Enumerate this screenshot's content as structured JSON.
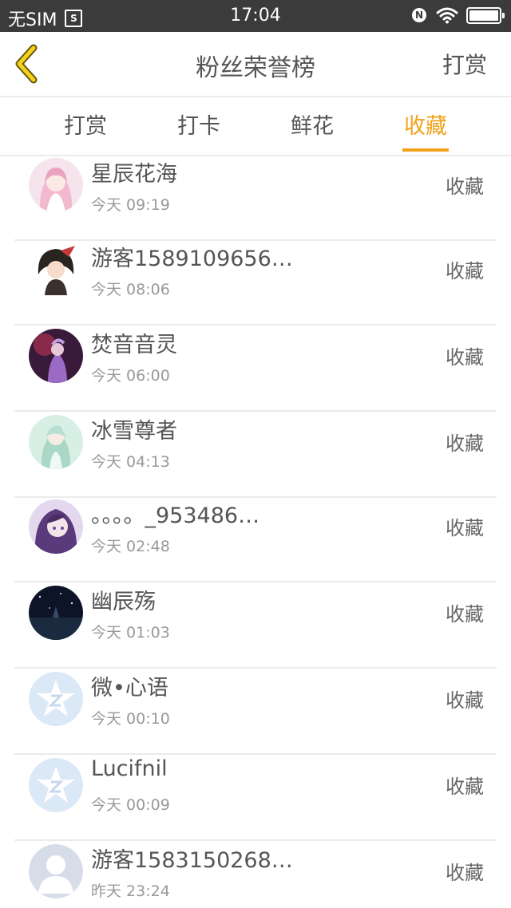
{
  "status_bar": {
    "carrier": "无SIM",
    "sim_icon_letter": "S",
    "time": "17:04",
    "nfc_letter": "N"
  },
  "nav": {
    "title": "粉丝荣誉榜",
    "right_action": "打赏"
  },
  "tabs": [
    {
      "label": "打赏",
      "active": false
    },
    {
      "label": "打卡",
      "active": false
    },
    {
      "label": "鲜花",
      "active": false
    },
    {
      "label": "收藏",
      "active": true
    }
  ],
  "colors": {
    "accent": "#f0a21a",
    "status_bar_bg": "#3b3b3b",
    "text_primary": "#555555",
    "text_secondary": "#999999"
  },
  "fans": [
    {
      "name": "星辰花海",
      "time": "今天 09:19",
      "action": "收藏",
      "avatar": "anime-girl-pink"
    },
    {
      "name": "游客1589109656…",
      "time": "今天 08:06",
      "action": "收藏",
      "avatar": "anime-boy-black"
    },
    {
      "name": "焚音音灵",
      "time": "今天 06:00",
      "action": "收藏",
      "avatar": "anime-purple-red"
    },
    {
      "name": "冰雪尊者",
      "time": "今天 04:13",
      "action": "收藏",
      "avatar": "anime-girl-green"
    },
    {
      "name": "。。。。_953486…",
      "time": "今天 02:48",
      "action": "收藏",
      "avatar": "anime-girl-purple"
    },
    {
      "name": "幽辰殇",
      "time": "今天 01:03",
      "action": "收藏",
      "avatar": "night-sky"
    },
    {
      "name": "微•心语",
      "time": "今天 00:10",
      "action": "收藏",
      "avatar": "default-qq-star"
    },
    {
      "name": "Lucifnil",
      "time": "今天 00:09",
      "action": "收藏",
      "avatar": "default-qq-star"
    },
    {
      "name": "游客1583150268…",
      "time": "昨天 23:24",
      "action": "收藏",
      "avatar": "default-person"
    }
  ]
}
